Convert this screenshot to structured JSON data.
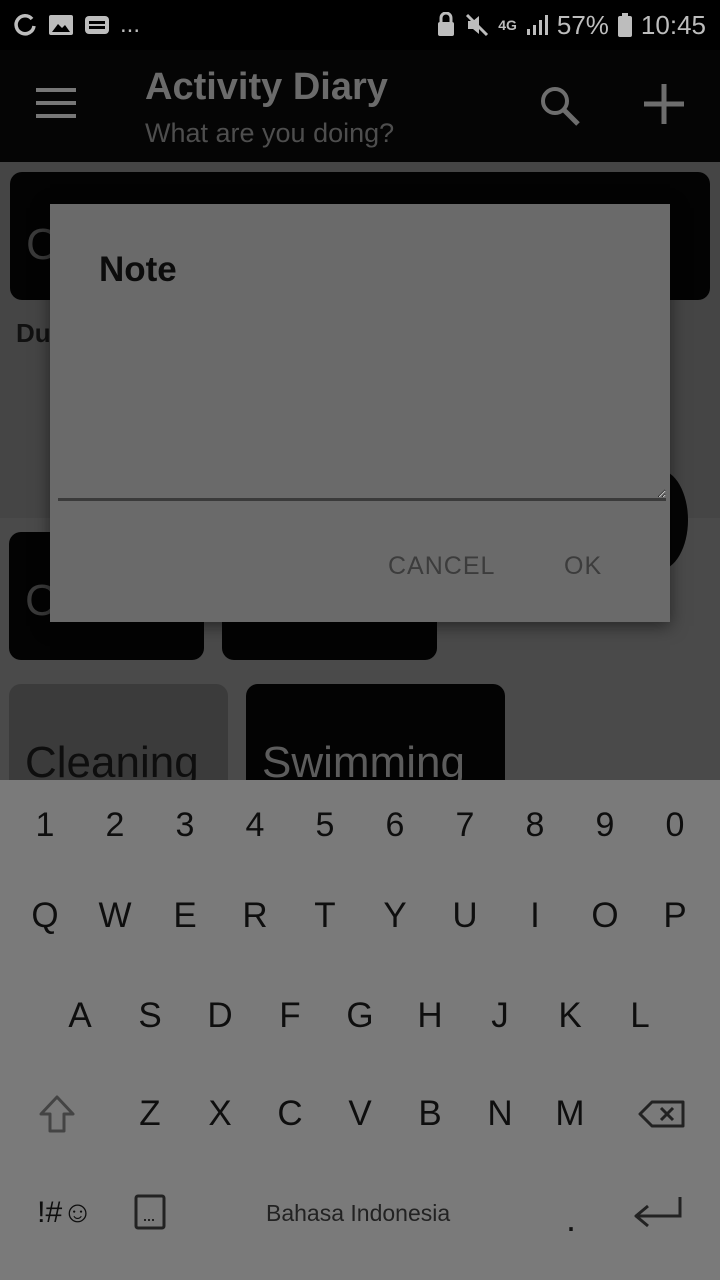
{
  "status_bar": {
    "overflow": "...",
    "network": "4G",
    "battery": "57%",
    "time": "10:45"
  },
  "app_bar": {
    "title": "Activity Diary",
    "subtitle": "What are you doing?"
  },
  "background": {
    "top_tile_partial": "C",
    "duration_partial": "Du",
    "row2_tile_partial": "C",
    "tiles": [
      "Cleaning",
      "Swimming"
    ]
  },
  "dialog": {
    "title": "Note",
    "note_value": "",
    "cancel_label": "CANCEL",
    "ok_label": "OK"
  },
  "keyboard": {
    "numbers": [
      "1",
      "2",
      "3",
      "4",
      "5",
      "6",
      "7",
      "8",
      "9",
      "0"
    ],
    "row1": [
      "Q",
      "W",
      "E",
      "R",
      "T",
      "Y",
      "U",
      "I",
      "O",
      "P"
    ],
    "row2": [
      "A",
      "S",
      "D",
      "F",
      "G",
      "H",
      "J",
      "K",
      "L"
    ],
    "row3": [
      "Z",
      "X",
      "C",
      "V",
      "B",
      "N",
      "M"
    ],
    "symbols_label": "!#☺",
    "language_label": "Bahasa Indonesia",
    "period_label": ".",
    "icons": {
      "shift": "shift-arrow-icon",
      "backspace": "backspace-icon",
      "clipboard": "clipboard-icon",
      "enter": "enter-icon"
    }
  }
}
